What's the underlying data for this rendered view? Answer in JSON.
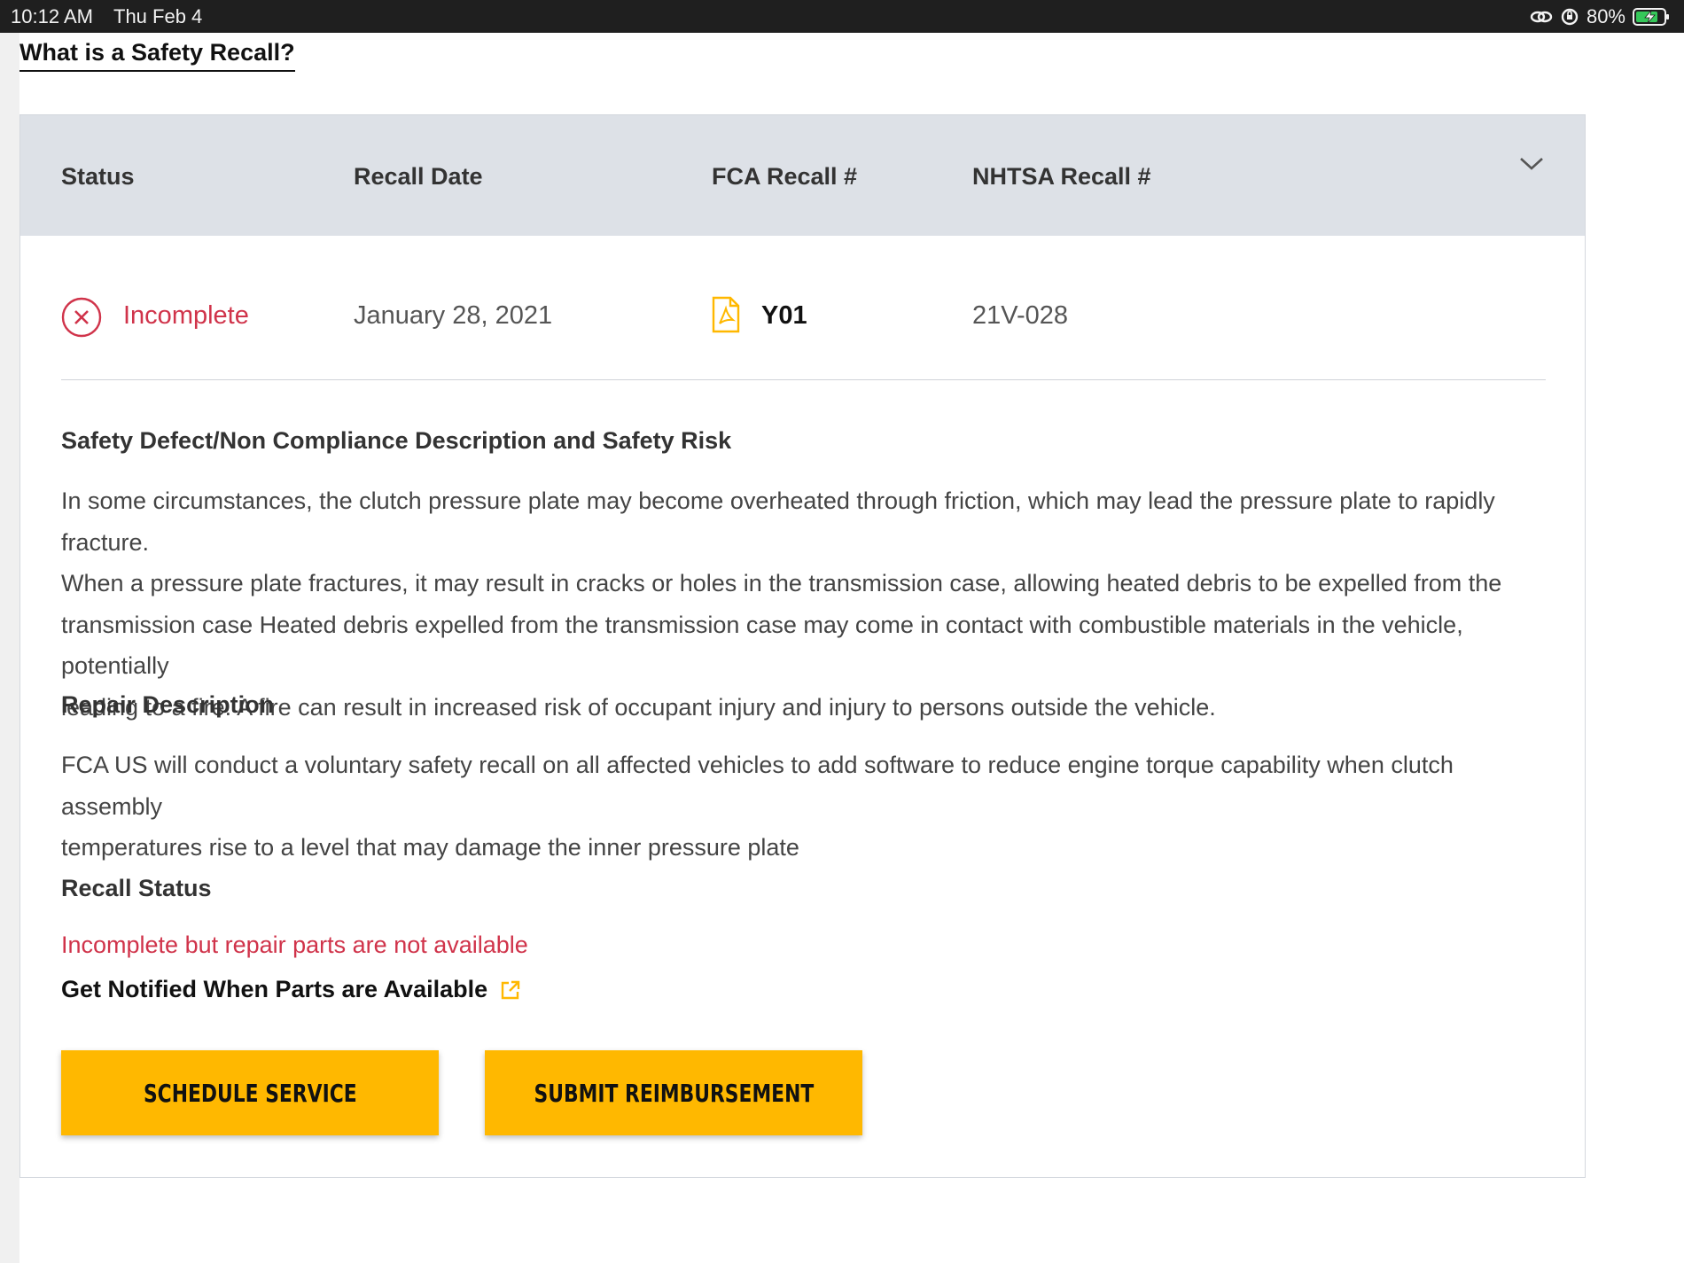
{
  "status_bar": {
    "time": "10:12 AM",
    "date": "Thu Feb 4",
    "battery": "80%"
  },
  "page": {
    "link_title": "What is a Safety Recall?"
  },
  "table": {
    "headers": {
      "status": "Status",
      "recall_date": "Recall Date",
      "fca": "FCA Recall #",
      "nhtsa": "NHTSA Recall #"
    },
    "row": {
      "status": "Incomplete",
      "recall_date": "January 28, 2021",
      "fca": "Y01",
      "nhtsa": "21V-028"
    }
  },
  "details": {
    "defect_heading": "Safety Defect/Non Compliance Description and Safety Risk",
    "defect_lines": [
      "In some circumstances, the clutch pressure plate may become overheated through friction, which may lead the pressure plate to rapidly fracture.",
      "When a pressure plate fractures, it may result in cracks or holes in the transmission case, allowing heated debris to be expelled from the",
      "transmission case Heated debris expelled from the transmission case may come in contact with combustible materials in the vehicle, potentially",
      "leading to a fire. A fire can result in increased risk of occupant injury and injury to persons outside the vehicle."
    ],
    "repair_heading": "Repair Description",
    "repair_lines": [
      "FCA US will conduct a voluntary safety recall on all affected vehicles to add software to reduce engine torque capability when clutch assembly",
      "temperatures rise to a level that may damage the inner pressure plate"
    ],
    "status_heading": "Recall Status",
    "status_text": "Incomplete but repair parts are not available",
    "notify_link": "Get Notified When Parts are Available"
  },
  "buttons": {
    "schedule": "SCHEDULE SERVICE",
    "reimburse": "SUBMIT REIMBURSEMENT"
  },
  "colors": {
    "accent_yellow": "#ffb800",
    "status_red": "#d0334a",
    "header_gray": "#dde1e7"
  }
}
